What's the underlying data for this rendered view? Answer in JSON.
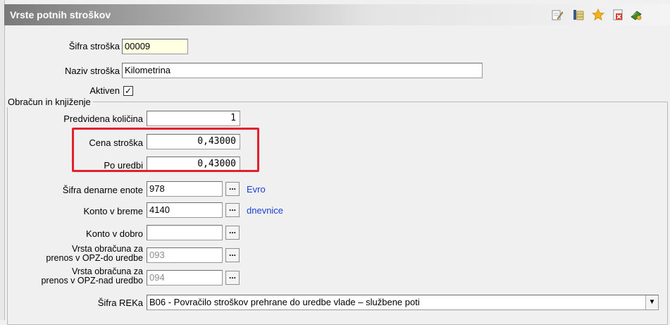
{
  "window": {
    "title": "Vrste potnih stroškov"
  },
  "toolbar": {
    "icons": [
      "edit-icon",
      "table-icon",
      "star-icon",
      "delete-icon",
      "book-icon"
    ],
    "colors": {
      "star": "#f2b21b",
      "delete": "#d93a2c"
    }
  },
  "form": {
    "sifra": {
      "label": "Šifra stroška",
      "value": "00009"
    },
    "naziv": {
      "label": "Naziv stroška",
      "value": "Kilometrina"
    },
    "aktiven": {
      "label": "Aktiven",
      "checked": true,
      "mark": "✓"
    }
  },
  "group": {
    "title": "Obračun in knjiženje",
    "predvidena": {
      "label": "Predvidena količina",
      "value": "1"
    },
    "cena": {
      "label": "Cena stroška",
      "value": "0,43000"
    },
    "uredbi": {
      "label": "Po uredbi",
      "value": "0,43000"
    },
    "denarna": {
      "label": "Šifra denarne enote",
      "value": "978",
      "desc": "Evro"
    },
    "breme": {
      "label": "Konto v breme",
      "value": "4140",
      "desc": "dnevnice"
    },
    "dobro": {
      "label": "Konto v dobro",
      "value": ""
    },
    "opz_do": {
      "label_line1": "Vrsta obračuna za",
      "label_line2": "prenos v OPZ-do uredbe",
      "value": "093"
    },
    "opz_nad": {
      "label_line1": "Vrsta obračuna za",
      "label_line2": "prenos v OPZ-nad uredbo",
      "value": "094"
    },
    "reka": {
      "label": "Šifra REKa",
      "value": "B06 - Povračilo stroškov prehrane do uredbe vlade – službene poti"
    },
    "ellipsis": "..."
  },
  "highlight_color": "#e3202d"
}
